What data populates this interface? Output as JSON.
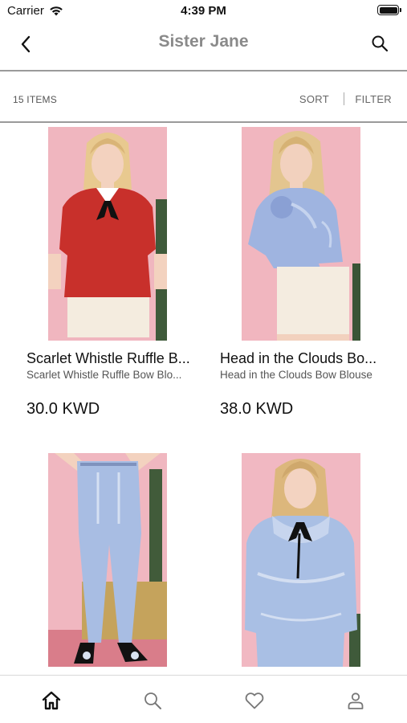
{
  "status_bar": {
    "carrier": "Carrier",
    "time": "4:39 PM"
  },
  "nav": {
    "title": "Sister Jane"
  },
  "toolbar": {
    "items_count": "15 ITEMS",
    "sort_label": "SORT",
    "filter_label": "FILTER"
  },
  "products": [
    {
      "name": "Scarlet Whistle Ruffle B...",
      "subtitle": "Scarlet Whistle Ruffle Bow Blo...",
      "price": "30.0 KWD"
    },
    {
      "name": "Head in the Clouds Bo...",
      "subtitle": "Head in the Clouds Bow Blouse",
      "price": "38.0 KWD"
    },
    {
      "name": "",
      "subtitle": "",
      "price": ""
    },
    {
      "name": "",
      "subtitle": "",
      "price": ""
    }
  ],
  "tab_bar": {
    "tabs": [
      "home-icon",
      "search-icon",
      "heart-icon",
      "profile-icon"
    ],
    "active": "home-icon"
  },
  "colors": {
    "title_gray": "#8a8a8a",
    "photo_pink": "#f0b6bf",
    "divider": "#9a9a9a"
  }
}
